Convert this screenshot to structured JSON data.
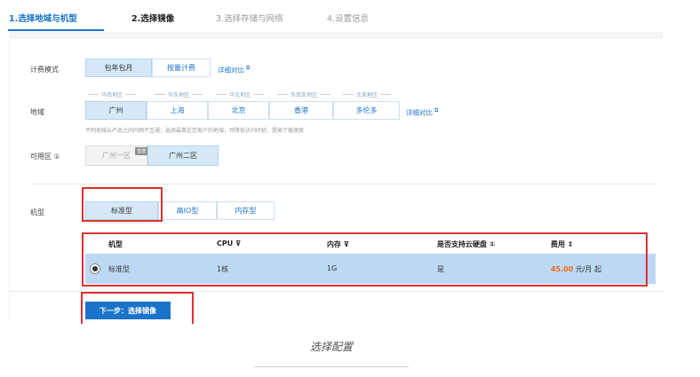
{
  "steps": [
    {
      "label": "1.选择地域与机型"
    },
    {
      "label": "2.选择镜像"
    },
    {
      "label": "3.选择存储与网络"
    },
    {
      "label": "4.设置信息"
    }
  ],
  "billing": {
    "label": "计费模式",
    "options": [
      "包年包月",
      "按量计费"
    ],
    "selected": "包年包月",
    "compare_link": "详细对比"
  },
  "region": {
    "label": "地域",
    "groups": [
      "华南地区",
      "华东地区",
      "华北地区",
      "东南亚地区",
      "北美地区"
    ],
    "options": [
      "广州",
      "上海",
      "北京",
      "香港",
      "多伦多"
    ],
    "selected": "广州",
    "compare_link": "详细对比",
    "hint": "不同地域云产品之间内网不互通；选择最靠近您客户的地域，可降低访问时延、提高下载速度"
  },
  "zone": {
    "label": "可用区 ①",
    "options": [
      "广州一区",
      "广州二区"
    ],
    "selected": "广州二区",
    "badge": "售罄"
  },
  "model": {
    "label": "机型",
    "options": [
      "标准型",
      "高IO型",
      "内存型"
    ],
    "selected": "标准型"
  },
  "table": {
    "headers": [
      "机型",
      "CPU ⊽",
      "内存 ⊽",
      "是否支持云硬盘 ①",
      "费用 ⇕"
    ],
    "rows": [
      {
        "type": "标准型",
        "cpu": "1核",
        "mem": "1G",
        "disk": "是",
        "price_num": "45.00",
        "price_unit": "元/月 起"
      }
    ]
  },
  "next_button": "下一步：选择镜像",
  "caption": "选择配置",
  "colors": {
    "accent": "#1a73c9",
    "highlight": "#e03030",
    "price": "#f06a16",
    "selected_row": "#bcd8f4"
  }
}
